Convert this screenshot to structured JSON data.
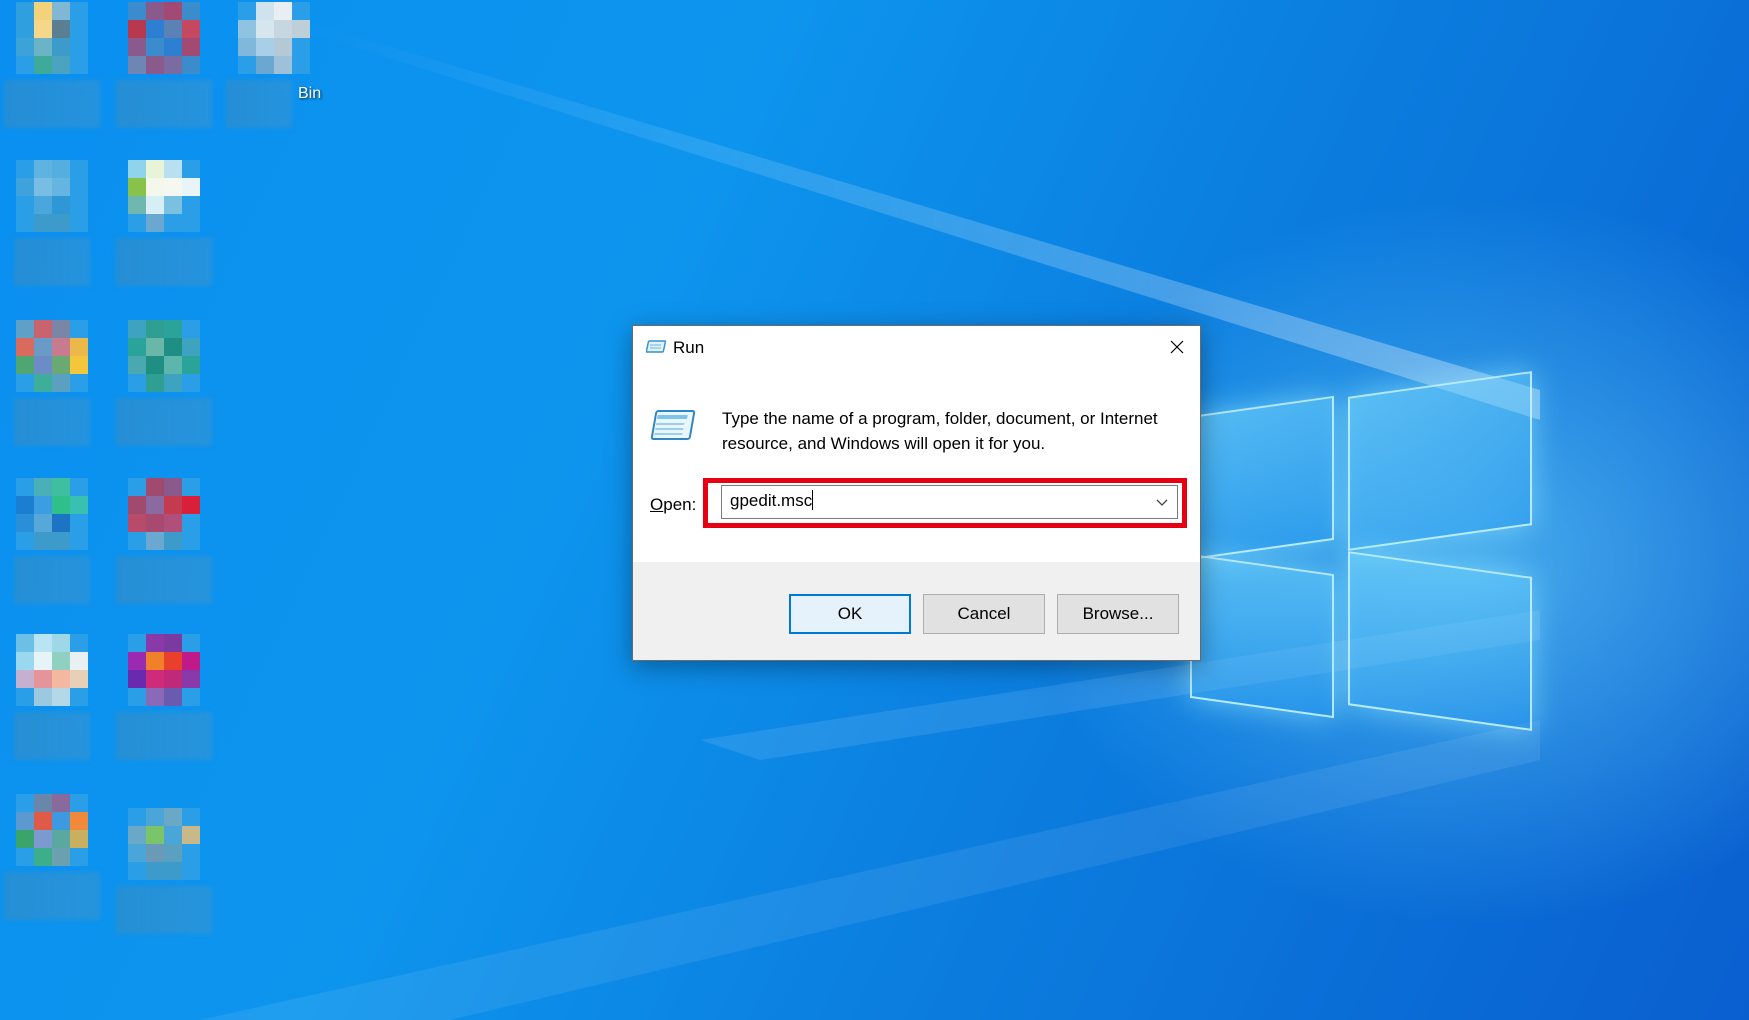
{
  "desktop": {
    "recycle_bin_label": "Bin",
    "accent_color": "#0a8ff0"
  },
  "run_dialog": {
    "title": "Run",
    "description": "Type the name of a program, folder, document, or Internet resource, and Windows will open it for you.",
    "open_label_prefix": "O",
    "open_label_rest": "pen:",
    "input_value": "gpedit.msc",
    "highlight_color": "#e60012",
    "buttons": {
      "ok": "OK",
      "cancel": "Cancel",
      "browse": "Browse..."
    },
    "icons": {
      "title": "run-icon",
      "close": "close-icon",
      "dropdown": "chevron-down-icon"
    }
  }
}
